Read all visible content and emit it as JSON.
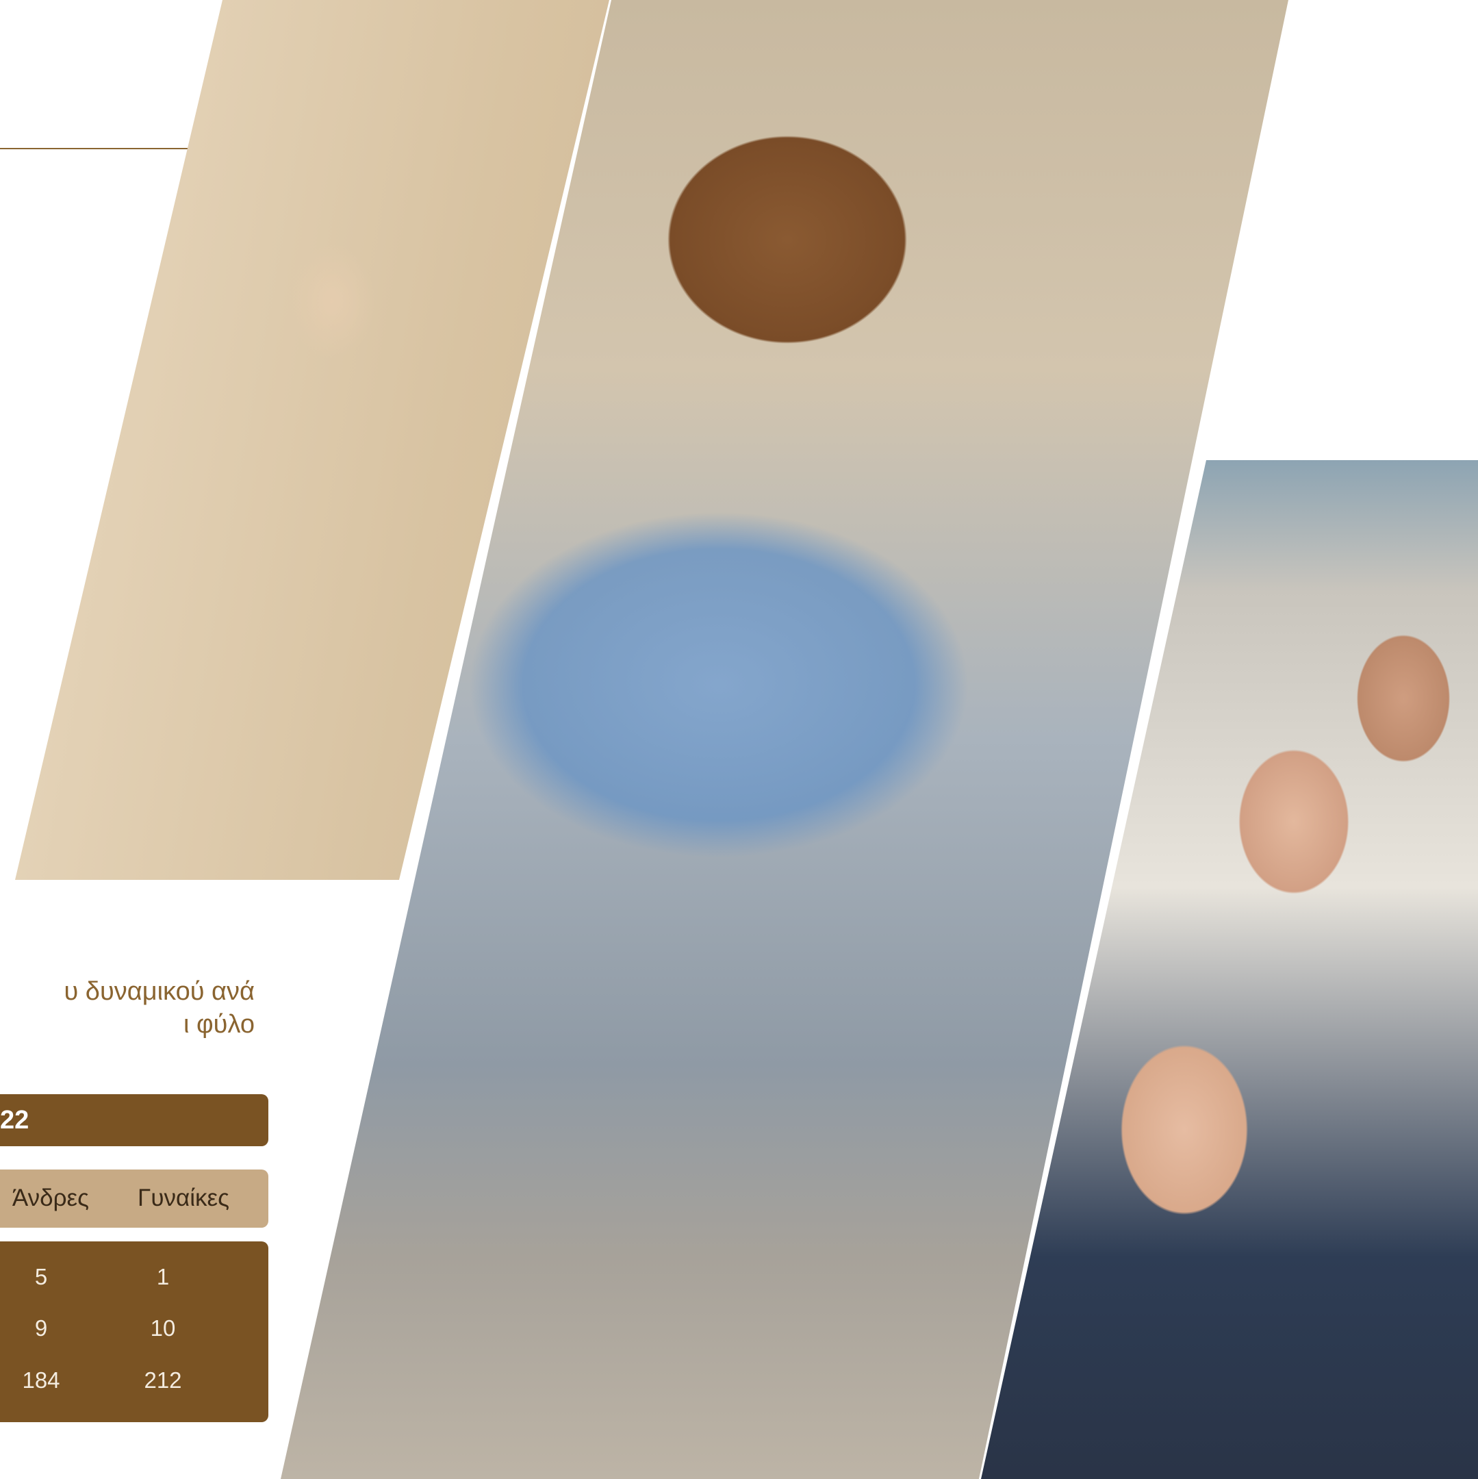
{
  "heading": {
    "line1": "υ δυναμικού ανά",
    "line2": "ι φύλο"
  },
  "table": {
    "year": "22",
    "columns": {
      "men": "Άνδρες",
      "women": "Γυναίκες"
    },
    "rows": [
      {
        "men": "5",
        "women": "1"
      },
      {
        "men": "9",
        "women": "10"
      },
      {
        "men": "184",
        "women": "212"
      }
    ]
  },
  "colors": {
    "brown": "#7a5323",
    "tan": "#c7aa85",
    "heading": "#8a6430"
  }
}
